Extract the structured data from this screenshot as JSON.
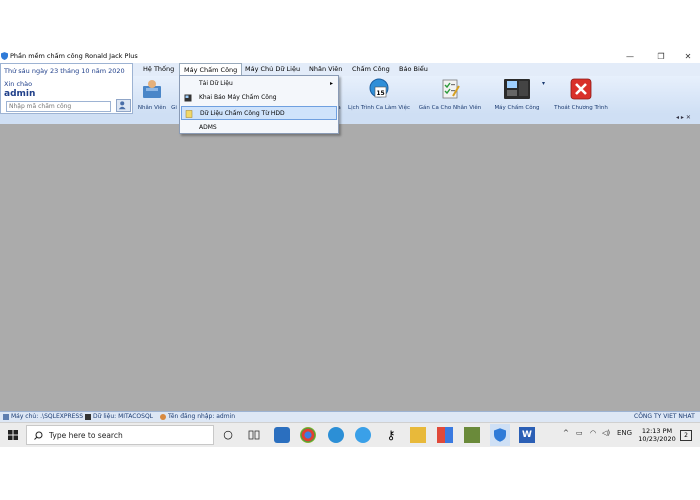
{
  "window": {
    "title": "Phần mềm chấm công Ronald Jack Plus",
    "controls": [
      "—",
      "❐",
      "✕"
    ]
  },
  "info": {
    "date": "Thứ sáu ngày 23 tháng 10 năm 2020",
    "greeting": "Xin chào",
    "user": "admin",
    "code_placeholder": "Nhập mã chấm công"
  },
  "menubar": {
    "items": [
      "Hệ Thống",
      "Máy Chấm Công",
      "Máy Chủ Dữ Liệu",
      "Nhân Viên",
      "Chấm Công",
      "Báo Biểu"
    ]
  },
  "ribbon": {
    "buttons": [
      {
        "label": "Nhân Viên"
      },
      {
        "label": "Gi"
      },
      {
        "label": "a"
      },
      {
        "label": "Lịch Trình Ca Làm Việc"
      },
      {
        "label": "Gán Ca Cho Nhân Viên"
      },
      {
        "label": "Máy Chấm Công"
      },
      {
        "label": "Thoát Chương Trình"
      }
    ],
    "calendar_number": "15"
  },
  "dropdown": {
    "items": [
      "Tải Dữ Liệu",
      "Khai Báo Máy Chấm Công",
      "Dữ Liệu Chấm Công Từ HDD",
      "ADMS"
    ],
    "submenu_arrow": "▸"
  },
  "strip": {
    "arrows": "◂ ▸ ✕"
  },
  "statusbar": {
    "server": "Máy chủ: .\\SQLEXPRESS",
    "database": "Dữ liệu: MITACOSQL",
    "login": "Tên đăng nhập: admin",
    "company": "CÔNG TY VIET NHAT"
  },
  "taskbar": {
    "search_placeholder": "Type here to search",
    "lang": "ENG",
    "time": "12:13 PM",
    "date": "10/23/2020",
    "notifications": "2"
  },
  "colors": {
    "workspace": "#ababab",
    "ribbon": "#cfdff4",
    "accent": "#1f3f8a",
    "exit_red": "#d9302a"
  }
}
